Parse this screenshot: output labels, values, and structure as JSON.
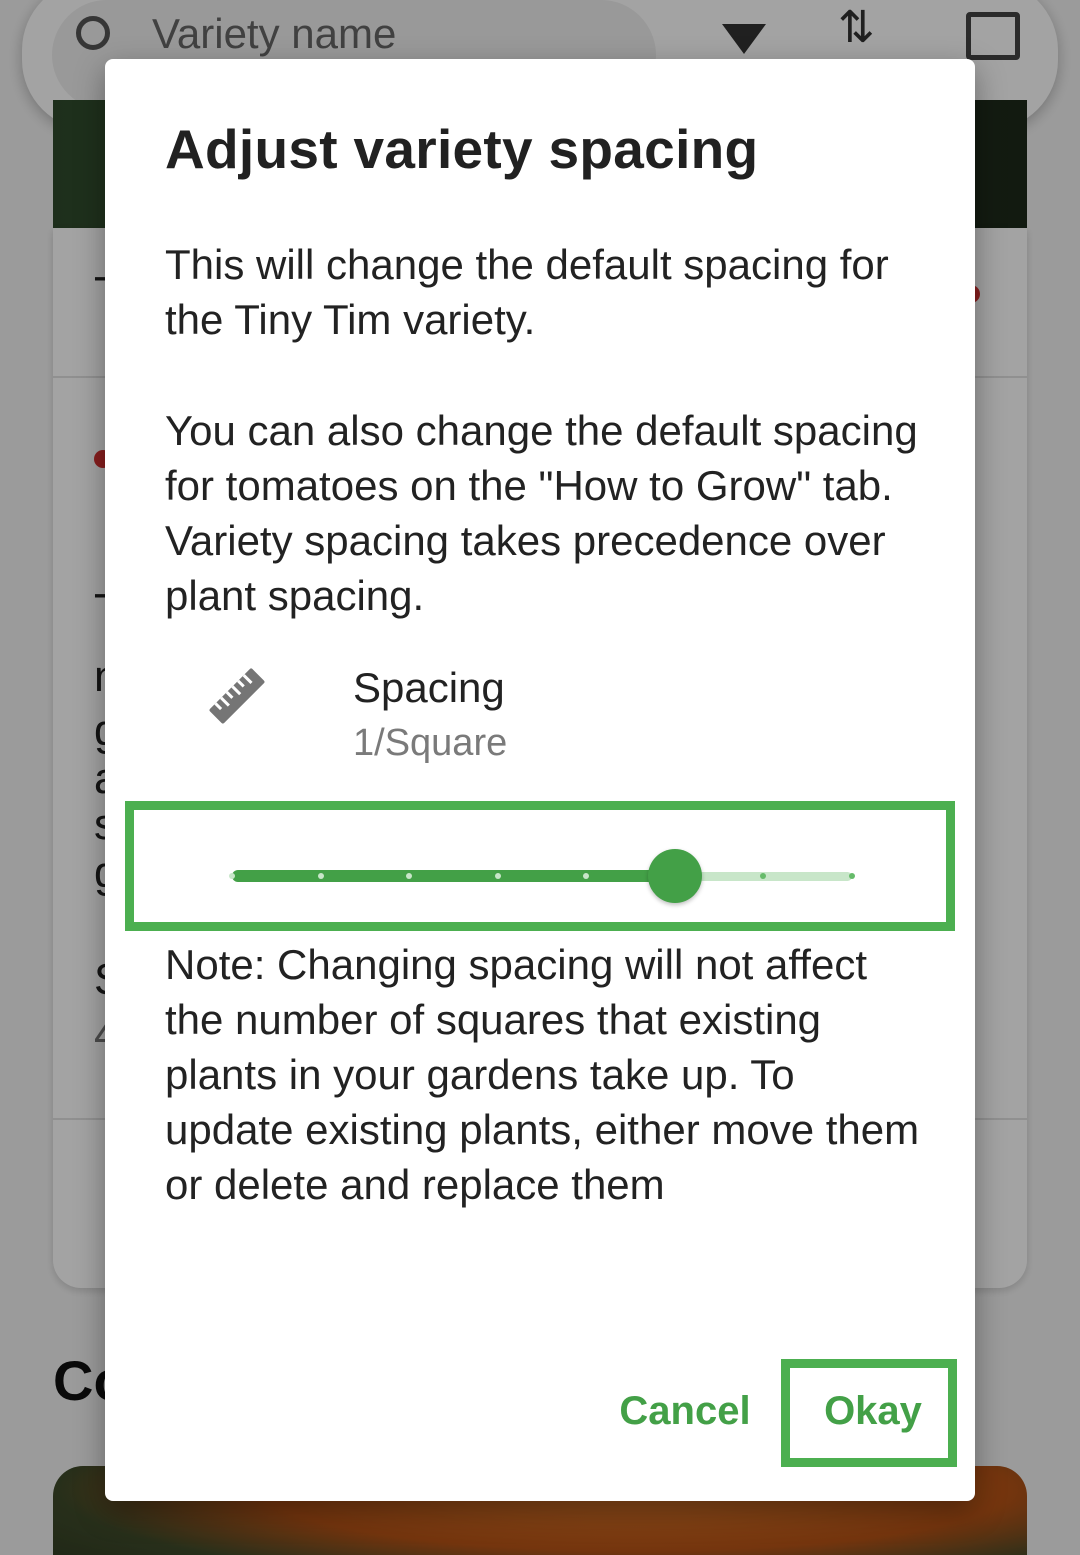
{
  "background": {
    "search_placeholder": "Variety name",
    "heading_fragment": "Co",
    "row_fragments": [
      "T",
      "T",
      "n",
      "g",
      "a",
      "s",
      "g",
      "S",
      "4"
    ]
  },
  "dialog": {
    "title": "Adjust variety spacing",
    "paragraph_1": "This will change the default spacing for the Tiny Tim variety.",
    "paragraph_2": "You can also change the default spacing for tomatoes on the \"How to Grow\" tab. Variety spacing takes precedence over plant spacing.",
    "spacing": {
      "icon": "ruler-icon",
      "label": "Spacing",
      "value": "1/Square"
    },
    "slider": {
      "steps": 8,
      "selected_index": 5
    },
    "note": "Note: Changing spacing will not affect the number of squares that existing plants in your gardens take up. To update existing plants, either move them or delete and replace them",
    "actions": {
      "cancel_label": "Cancel",
      "okay_label": "Okay"
    }
  },
  "colors": {
    "accent": "#43a047",
    "highlight": "#4caf50",
    "track_inactive": "#c8e6c9",
    "scrim": "rgba(0,0,0,0.36)"
  }
}
